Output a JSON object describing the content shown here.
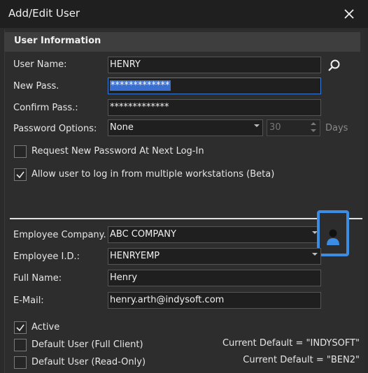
{
  "window": {
    "title": "Add/Edit User"
  },
  "section": {
    "user_information": "User Information"
  },
  "labels": {
    "user_name": "User Name:",
    "new_pass": "New Pass.",
    "confirm_pass": "Confirm Pass.:",
    "password_options": "Password Options:",
    "days": "Days",
    "employee_company": "Employee Company.",
    "employee_id": "Employee I.D.:",
    "full_name": "Full Name:",
    "email": "E-Mail:"
  },
  "fields": {
    "user_name": "HENRY",
    "new_pass": "*************",
    "confirm_pass": "*************",
    "password_option": "None",
    "days_value": "30",
    "employee_company": "ABC COMPANY",
    "employee_id": "HENRYEMP",
    "full_name": "Henry",
    "email": "henry.arth@indysoft.com"
  },
  "checkboxes": {
    "request_new_password": {
      "label": "Request New Password At Next Log-In",
      "checked": false
    },
    "multiple_workstations": {
      "label": "Allow user to log in from multiple workstations (Beta)",
      "checked": true
    },
    "active": {
      "label": "Active",
      "checked": true
    },
    "default_full_client": {
      "label": "Default User (Full Client)",
      "checked": false
    },
    "default_read_only": {
      "label": "Default User (Read-Only)",
      "checked": false
    }
  },
  "defaults": {
    "full_client": "Current Default = \"INDYSOFT\"",
    "read_only": "Current Default = \"BEN2\""
  },
  "icons": {
    "close": "close-icon",
    "search": "search-icon",
    "employee_photo": "person-icon"
  },
  "colors": {
    "accent": "#3c8ce3",
    "selection": "#3a6fd0",
    "background": "#2b2b2b"
  }
}
